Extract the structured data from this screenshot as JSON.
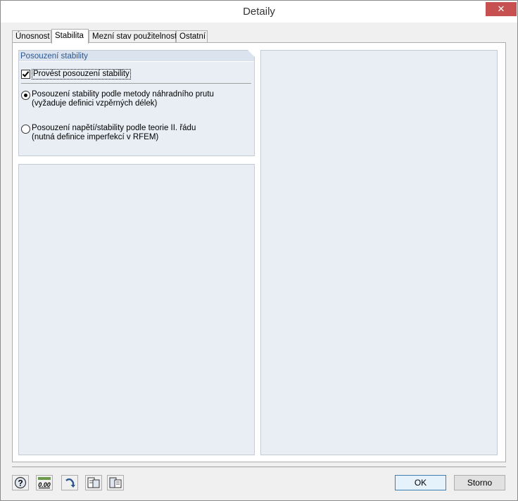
{
  "window": {
    "title": "Detaily",
    "close_glyph": "✕"
  },
  "tabs": [
    {
      "label": "Únosnost",
      "active": false
    },
    {
      "label": "Stabilita",
      "active": true
    },
    {
      "label": "Mezní stav použitelnosti",
      "active": false
    },
    {
      "label": "Ostatní",
      "active": false
    }
  ],
  "stability_group": {
    "header": "Posouzení stability",
    "checkbox": {
      "label": "Provést posouzení stability",
      "checked": true
    },
    "radios": [
      {
        "line1": "Posouzení stability podle metody náhradního prutu",
        "line2": "(vyžaduje definici vzpěrných délek)",
        "selected": true
      },
      {
        "line1": "Posouzení napětí/stability podle teorie II. řádu",
        "line2": "(nutná definice imperfekcí v RFEM)",
        "selected": false
      }
    ]
  },
  "footer": {
    "icons": [
      "help-icon",
      "decimal-places-icon",
      "reset-arrow-icon",
      "export-icon",
      "import-icon"
    ],
    "decimal_icon_text": "0.00",
    "ok_label": "OK",
    "cancel_label": "Storno"
  },
  "colors": {
    "close_button": "#c75050",
    "group_header_text": "#2a5690",
    "pane_background": "#e9eef4"
  }
}
